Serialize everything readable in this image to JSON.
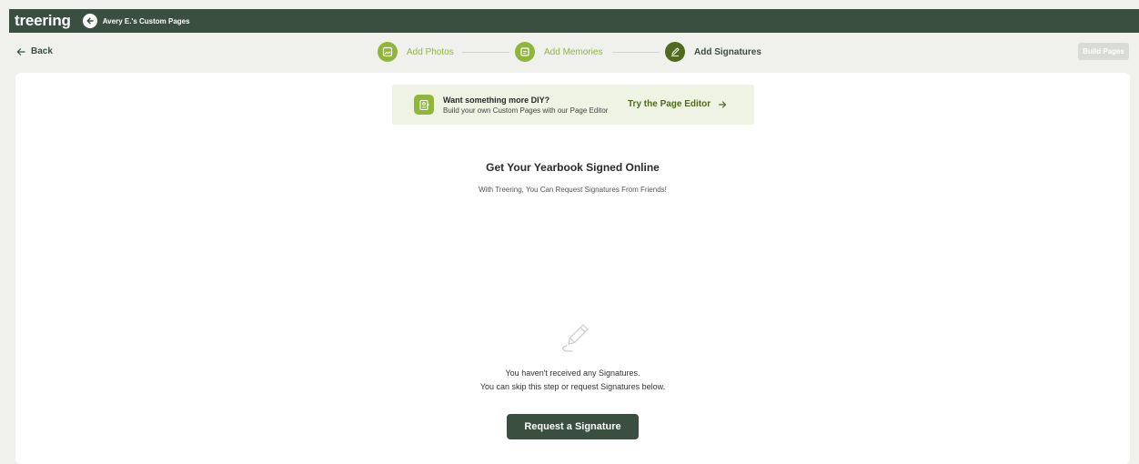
{
  "topbar": {
    "logo": "treering",
    "title": "Avery E.'s Custom Pages"
  },
  "nav": {
    "back_label": "Back",
    "steps": [
      {
        "label": "Add Photos",
        "state": "done",
        "icon": "photo-icon"
      },
      {
        "label": "Add Memories",
        "state": "done",
        "icon": "memories-icon"
      },
      {
        "label": "Add Signatures",
        "state": "active",
        "icon": "pen-icon"
      }
    ],
    "build_label": "Build Pages"
  },
  "diy": {
    "title": "Want something more DIY?",
    "subtitle": "Build your own Custom Pages with our Page Editor",
    "link_label": "Try the Page Editor",
    "icon": "page-editor-icon"
  },
  "main": {
    "heading": "Get Your Yearbook Signed Online",
    "subheading": "With Treering, You Can Request Signatures From Friends!",
    "empty_line1": "You haven't received any Signatures.",
    "empty_line2": "You can skip this step or request Signatures below.",
    "request_label": "Request a Signature",
    "empty_icon": "pen-icon"
  },
  "colors": {
    "brand_dark": "#3a4f3f",
    "step_done": "#8fb63b",
    "step_active": "#4e6b1f",
    "diy_bg": "#eef3e3",
    "page_bg": "#f0f0ed"
  }
}
